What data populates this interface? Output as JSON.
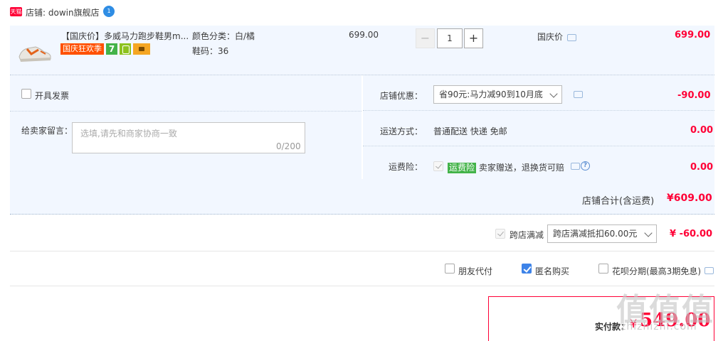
{
  "store": {
    "badge": "天猫",
    "label": "店铺: dowin旗舰店",
    "ww_text": "1"
  },
  "item": {
    "title": "【国庆价】多威马力跑步鞋男m...",
    "badges": {
      "promo": "国庆狂欢季",
      "seven": "7"
    },
    "sku_color": "颜色分类：白/橘",
    "sku_size": "鞋码：36",
    "unit_price": "699.00",
    "quantity": "1",
    "minus": "−",
    "plus": "+",
    "promo_name": "国庆价",
    "total": "699.00"
  },
  "invoice": {
    "label": "开具发票"
  },
  "message": {
    "label": "给卖家留言：",
    "placeholder": "选填,请先和商家协商一致",
    "count": "0/200"
  },
  "store_discount": {
    "label": "店铺优惠：",
    "selected": "省90元:马力减90到10月底",
    "amount": "-90.00"
  },
  "shipping": {
    "label": "运送方式：",
    "value": "普通配送 快递 免邮",
    "amount": "0.00"
  },
  "insurance": {
    "label": "运费险：",
    "badge": "运费险",
    "text": "卖家赠送，退换货可赔",
    "help": "?",
    "amount": "0.00"
  },
  "store_total": {
    "label": "店铺合计(含运费)",
    "amount": "¥609.00"
  },
  "cross_store": {
    "label": "跨店满减",
    "selected": "跨店满减抵扣60.00元",
    "amount": "¥ -60.00"
  },
  "options": {
    "friend_pay": "朋友代付",
    "anonymous": "匿名购买",
    "huabei": "花呗分期(最高3期免息)"
  },
  "payment": {
    "label": "实付款：",
    "currency": "¥",
    "amount": "549.00"
  },
  "watermark": {
    "main": "值值值",
    "sub": "zhizhizhi.com"
  },
  "colors": {
    "accent_red": "#ff0036",
    "panel_bg": "#f2f7ff",
    "checkbox_blue": "#3d83e8",
    "promo_orange": "#ff5000",
    "green": "#43b349"
  }
}
